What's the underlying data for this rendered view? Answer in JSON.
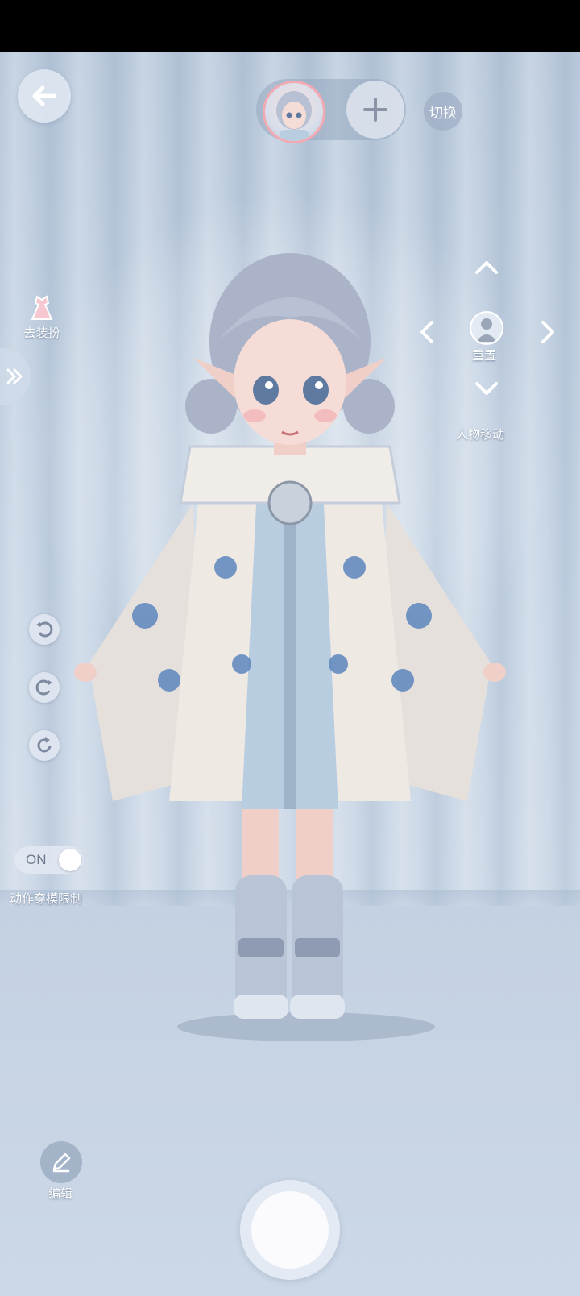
{
  "topbar": {
    "switch_label": "切换"
  },
  "left_panel": {
    "dress_label": "去装扮",
    "motion_limit_toggle": {
      "state_label": "ON",
      "label": "动作穿模限制"
    }
  },
  "right_panel": {
    "reset_label": "重置",
    "move_label": "人物移动"
  },
  "bottom": {
    "edit_label": "编辑"
  },
  "icons": {
    "back": "back-arrow-icon",
    "add": "plus-icon",
    "dress": "dress-icon",
    "expand": "double-chevron-right-icon",
    "undo": "undo-icon",
    "redo": "redo-icon",
    "reset_pose": "refresh-icon",
    "edit": "pencil-icon",
    "move_up": "chevron-up-icon",
    "move_down": "chevron-down-icon",
    "move_left": "chevron-left-icon",
    "move_right": "chevron-right-icon"
  },
  "colors": {
    "avatar_border": "#f2a9b2",
    "background": "#c5d4e4"
  }
}
